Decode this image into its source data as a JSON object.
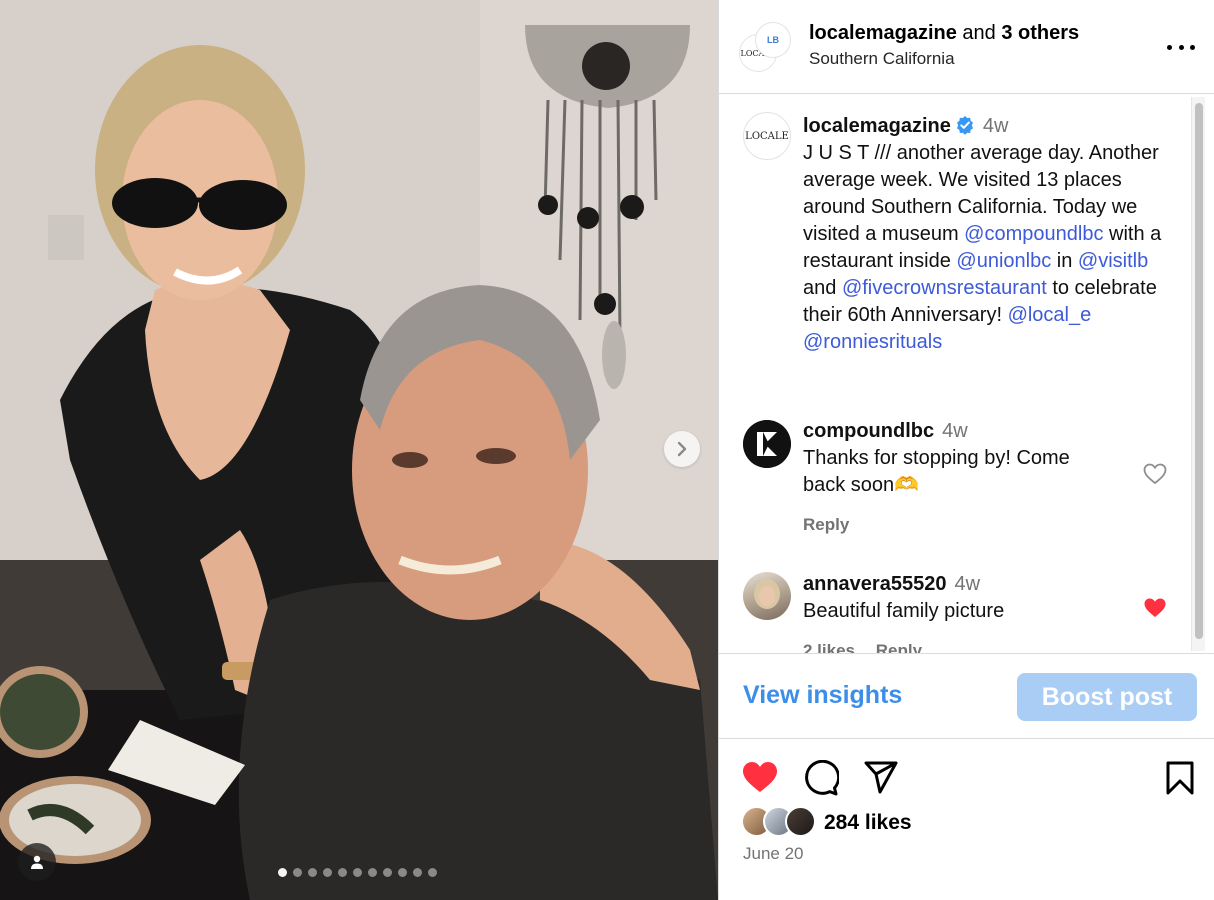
{
  "post": {
    "owner": "localemagazine",
    "collab_joiner": "and",
    "collab_others": "3 others",
    "location": "Southern California",
    "owner_logo_text": "LOCALE",
    "collab_logo_text": "LB"
  },
  "caption": {
    "username": "localemagazine",
    "time": "4w",
    "segments": [
      {
        "t": "J U S T /// another average day. Another average week.  We visited 13 places around Southern California. Today we visited  a museum "
      },
      {
        "t": "@compoundlbc",
        "mention": true
      },
      {
        "t": "  with a restaurant inside "
      },
      {
        "t": "@unionlbc",
        "mention": true
      },
      {
        "t": " in "
      },
      {
        "t": "@visitlb",
        "mention": true
      },
      {
        "t": " and "
      },
      {
        "t": "@fivecrownsrestaurant",
        "mention": true
      },
      {
        "t": " to celebrate their 60th Anniversary! "
      },
      {
        "t": "@local_e",
        "mention": true
      },
      {
        "t": " "
      },
      {
        "t": "@ronniesrituals",
        "mention": true
      }
    ]
  },
  "comments": [
    {
      "username": "compoundlbc",
      "time": "4w",
      "text": "Thanks for stopping by! Come back soon🫶",
      "likes": "",
      "reply": "Reply",
      "liked": false
    },
    {
      "username": "annavera55520",
      "time": "4w",
      "text": "Beautiful family picture",
      "likes": "2 likes",
      "reply": "Reply",
      "liked": true
    }
  ],
  "insights": {
    "view_label": "View insights",
    "boost_label": "Boost post"
  },
  "footer": {
    "likes": "284 likes",
    "date": "June 20"
  },
  "carousel": {
    "total": 11,
    "current": 1
  },
  "colors": {
    "link": "#3d5ad8",
    "insights": "#3d8ee8",
    "boost_bg": "#a9cdf5",
    "like_red": "#ff3040",
    "verified": "#3897f0"
  },
  "icons": [
    "chevron-right-icon",
    "user-tag-icon",
    "more-options-icon",
    "verified-badge-icon",
    "heart-icon",
    "comment-icon",
    "share-icon",
    "bookmark-icon"
  ]
}
